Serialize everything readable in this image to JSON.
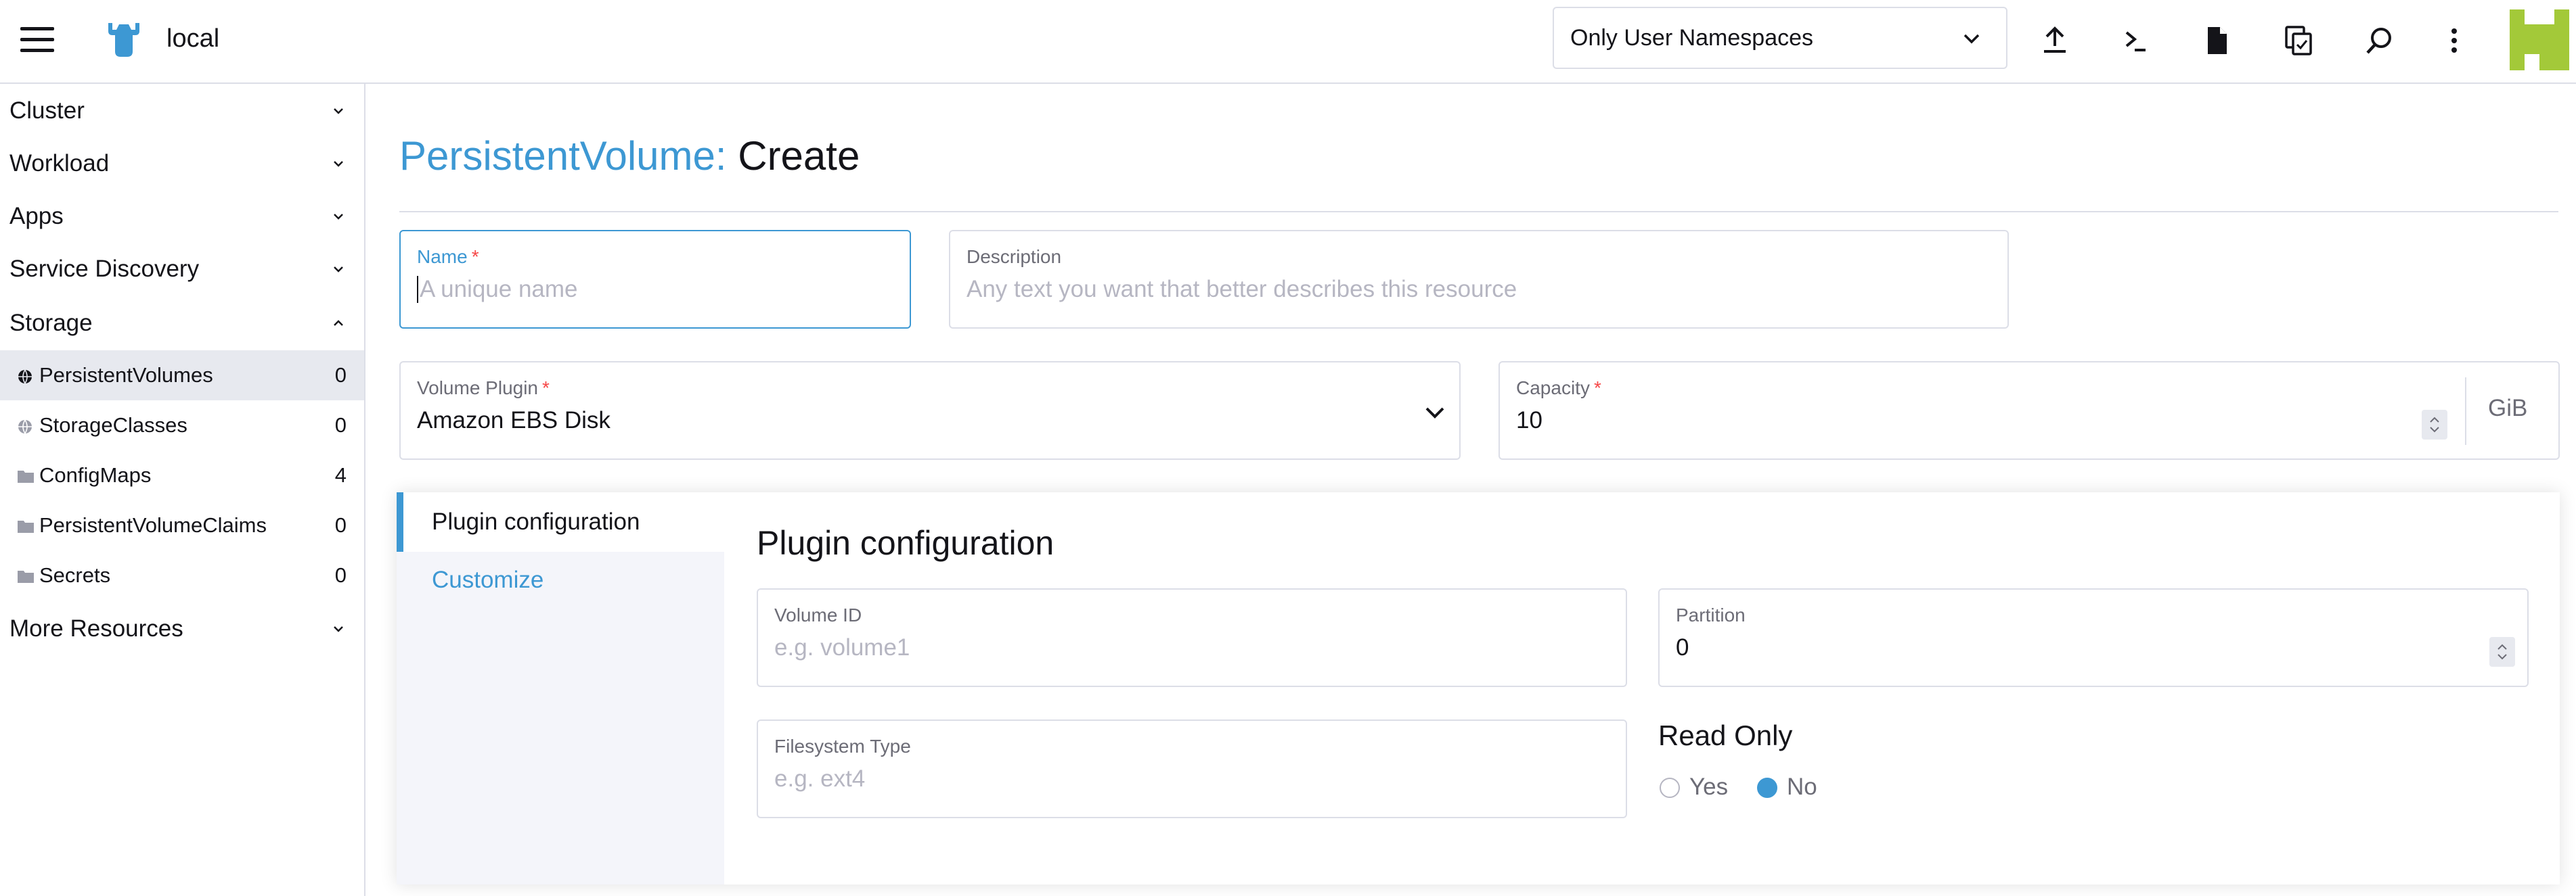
{
  "header": {
    "cluster_name": "local",
    "namespace_filter": "Only User Namespaces",
    "icons": [
      "menu-icon",
      "cluster-logo",
      "upload-icon",
      "terminal-icon",
      "file-icon",
      "copy-config-icon",
      "search-icon",
      "more-vertical-icon",
      "avatar"
    ]
  },
  "sidebar": {
    "groups": [
      {
        "label": "Cluster"
      },
      {
        "label": "Workload"
      },
      {
        "label": "Apps"
      },
      {
        "label": "Service Discovery"
      },
      {
        "label": "Storage"
      },
      {
        "label": "More Resources"
      }
    ],
    "storage_items": [
      {
        "label": "PersistentVolumes",
        "count": "0",
        "icon": "globe-icon"
      },
      {
        "label": "StorageClasses",
        "count": "0",
        "icon": "globe-icon"
      },
      {
        "label": "ConfigMaps",
        "count": "4",
        "icon": "folder-icon"
      },
      {
        "label": "PersistentVolumeClaims",
        "count": "0",
        "icon": "folder-icon"
      },
      {
        "label": "Secrets",
        "count": "0",
        "icon": "folder-icon"
      }
    ]
  },
  "page": {
    "title_type": "PersistentVolume:",
    "title_action": "Create"
  },
  "form": {
    "name": {
      "label": "Name",
      "required": "*",
      "placeholder": "A unique name"
    },
    "description": {
      "label": "Description",
      "placeholder": "Any text you want that better describes this resource"
    },
    "volume_plugin": {
      "label": "Volume Plugin",
      "required": "*",
      "value": "Amazon EBS Disk"
    },
    "capacity": {
      "label": "Capacity",
      "required": "*",
      "value": "10",
      "unit": "GiB"
    }
  },
  "tabs": [
    {
      "label": "Plugin configuration"
    },
    {
      "label": "Customize"
    }
  ],
  "plugin_config": {
    "title": "Plugin configuration",
    "volume_id": {
      "label": "Volume ID",
      "placeholder": "e.g. volume1"
    },
    "partition": {
      "label": "Partition",
      "value": "0"
    },
    "filesystem_type": {
      "label": "Filesystem Type",
      "placeholder": "e.g. ext4"
    },
    "read_only": {
      "title": "Read Only",
      "yes": "Yes",
      "no": "No",
      "selected": "No"
    }
  },
  "colors": {
    "accent": "#3d98d3",
    "required": "#f64747",
    "border": "#dcdee7",
    "avatar": "#a3c939"
  }
}
